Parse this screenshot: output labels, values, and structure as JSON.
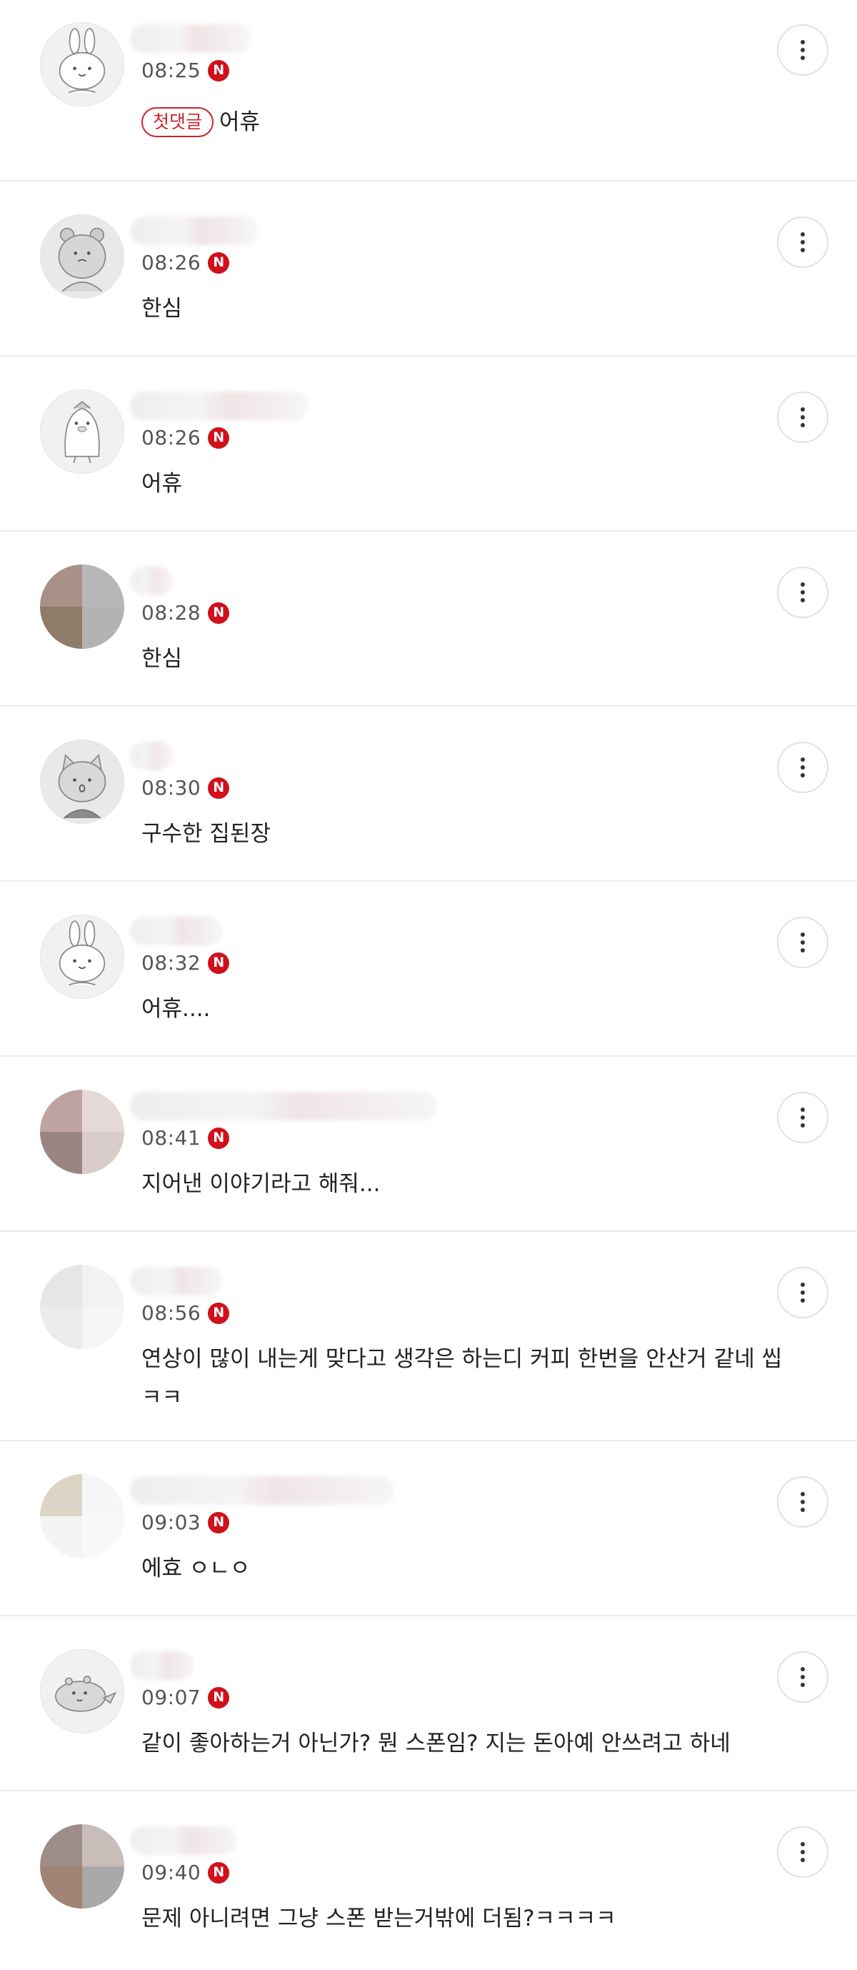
{
  "accent_color": "#d0101b",
  "badge_icon_name": "naver-n-badge-icon",
  "badge_letter": "N",
  "more_icon_name": "more-vertical-icon",
  "comments": [
    {
      "time": "08:25",
      "first_badge": "첫댓글",
      "text": "어휴",
      "avatar": "rabbit"
    },
    {
      "time": "08:26",
      "text": "한심",
      "avatar": "bear"
    },
    {
      "time": "08:26",
      "text": "어휴",
      "avatar": "penguin"
    },
    {
      "time": "08:28",
      "text": "한심",
      "avatar": "photo"
    },
    {
      "time": "08:30",
      "text": "구수한 집된장",
      "avatar": "cat"
    },
    {
      "time": "08:32",
      "text": "어휴....",
      "avatar": "rabbit"
    },
    {
      "time": "08:41",
      "text": "지어낸 이야기라고 해줘...",
      "avatar": "photo"
    },
    {
      "time": "08:56",
      "text": "연상이 많이 내는게 맞다고 생각은 하는디 커피 한번을 안산거 같네 씹 ㅋㅋ",
      "avatar": "photo"
    },
    {
      "time": "09:03",
      "text": "에효 ㅇㄴㅇ",
      "avatar": "photo"
    },
    {
      "time": "09:07",
      "text": "같이 좋아하는거 아닌가? 뭔 스폰임? 지는 돈아예 안쓰려고 하네",
      "avatar": "dino"
    },
    {
      "time": "09:40",
      "text": "문제 아니려면 그냥 스폰 받는거밖에 더됨?ㅋㅋㅋㅋ",
      "avatar": "photo"
    }
  ]
}
